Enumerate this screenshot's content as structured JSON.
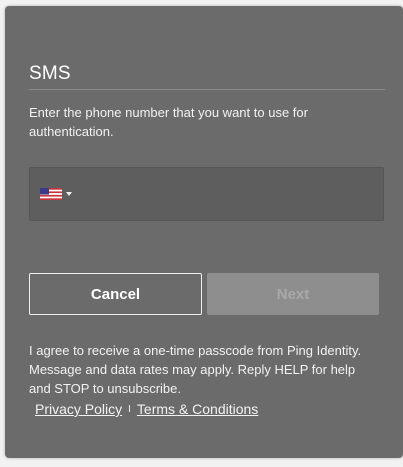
{
  "dialog": {
    "title": "SMS",
    "instructions": "Enter the phone number that you want to use for authentication."
  },
  "phone": {
    "country_icon": "us-flag-icon",
    "value": "",
    "placeholder": ""
  },
  "actions": {
    "cancel_label": "Cancel",
    "next_label": "Next"
  },
  "consent": {
    "text": "I agree to receive a one-time passcode from Ping Identity. Message and data rates may apply. Reply HELP for help and STOP to unsubscribe.",
    "privacy_label": "Privacy Policy",
    "separator": "I",
    "terms_label": "Terms & Conditions"
  },
  "colors": {
    "card_background": "#6b6b6b",
    "field_background": "#5e5e5e",
    "disabled_button": "#8e8e8e",
    "text": "#f2f2f2"
  }
}
